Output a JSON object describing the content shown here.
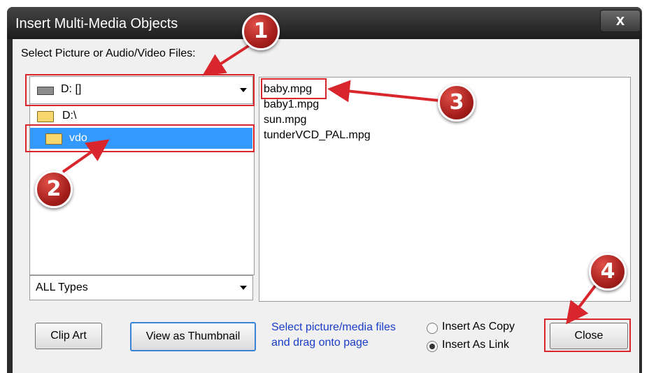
{
  "window": {
    "title": "Insert Multi-Media Objects",
    "close_glyph": "x"
  },
  "prompt": "Select Picture or Audio/Video Files:",
  "drive": {
    "icon": "drive-icon",
    "value": "D: []"
  },
  "folders": [
    {
      "label": "D:\\",
      "icon": "folder-open-icon",
      "selected": false
    },
    {
      "label": "vdo",
      "icon": "folder-open-icon",
      "selected": true
    }
  ],
  "types": {
    "value": "ALL Types"
  },
  "files": [
    "baby.mpg",
    "baby1.mpg",
    "sun.mpg",
    "tunderVCD_PAL.mpg"
  ],
  "buttons": {
    "clip_art": "Clip Art",
    "view_thumbnail": "View as Thumbnail",
    "close": "Close"
  },
  "hint": {
    "line1": "Select picture/media files",
    "line2": "and drag onto page"
  },
  "options": [
    {
      "label": "Insert As Copy",
      "selected": false
    },
    {
      "label": "Insert As Link",
      "selected": true
    }
  ],
  "annotations": {
    "colors": {
      "marker": "#d8262c"
    },
    "steps": [
      "1",
      "2",
      "3",
      "4"
    ]
  }
}
